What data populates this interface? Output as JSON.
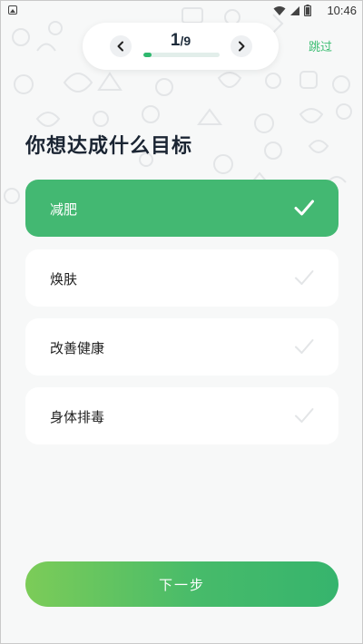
{
  "status_bar": {
    "time": "10:46",
    "icons": [
      "wifi-icon",
      "signal-icon",
      "battery-icon"
    ]
  },
  "progress": {
    "current": "1",
    "total": "/9",
    "fraction": 0.111
  },
  "skip_label": "跳过",
  "title": "你想达成什么目标",
  "options": [
    {
      "label": "减肥",
      "selected": true
    },
    {
      "label": "焕肤",
      "selected": false
    },
    {
      "label": "改善健康",
      "selected": false
    },
    {
      "label": "身体排毒",
      "selected": false
    }
  ],
  "next_label": "下一步",
  "colors": {
    "accent": "#43b872",
    "skip": "#3cbd72",
    "title": "#1b2533"
  }
}
